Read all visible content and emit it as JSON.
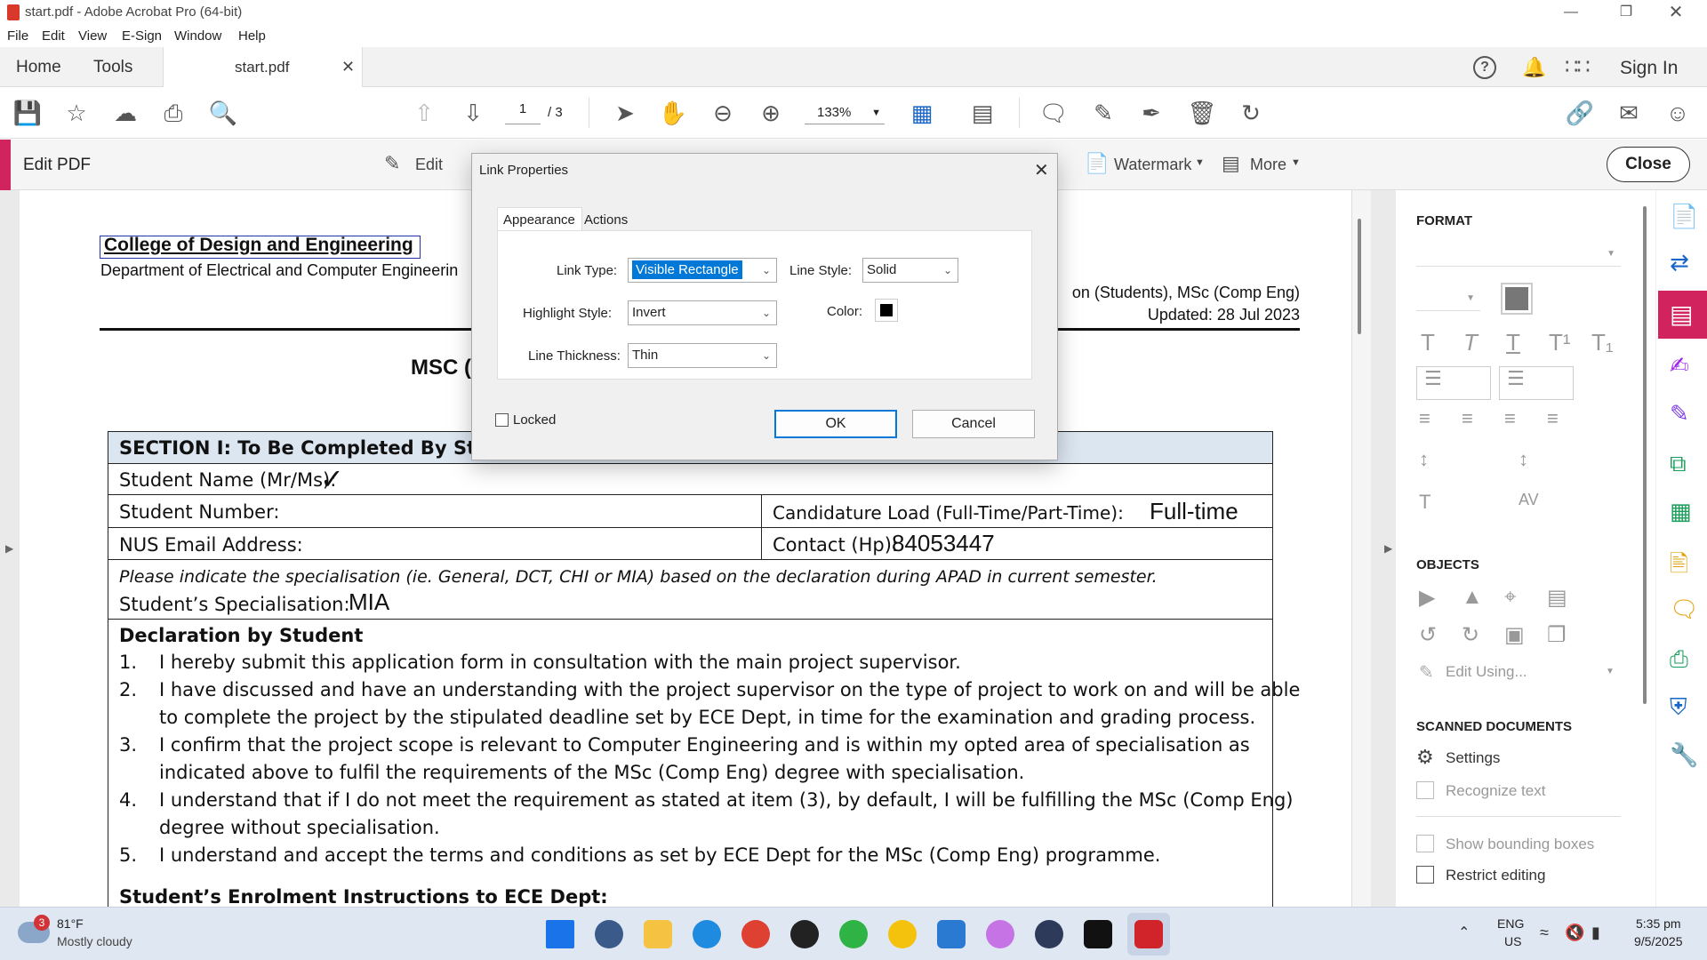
{
  "window": {
    "title": "start.pdf - Adobe Acrobat Pro (64-bit)"
  },
  "menu": [
    "File",
    "Edit",
    "View",
    "E-Sign",
    "Window",
    "Help"
  ],
  "tabs": {
    "home": "Home",
    "tools": "Tools",
    "doc": "start.pdf",
    "sign_in": "Sign In"
  },
  "toolbar": {
    "page_current": "1",
    "page_total": "/ 3",
    "zoom": "133%"
  },
  "editbar": {
    "title": "Edit PDF",
    "edit": "Edit",
    "watermark": "Watermark",
    "more": "More",
    "close": "Close"
  },
  "document": {
    "org": "College of Design and Engineering",
    "dept": "Department of Electrical and Computer Engineerin",
    "header_right_1": "on (Students), MSc (Comp Eng)",
    "header_right_2": "Updated: 28 Jul 2023",
    "heading_fragment": "MSC (",
    "section_header": "SECTION I: To Be Completed By Stude",
    "student_name_label": "Student Name (Mr/Ms):",
    "student_number_label": "Student Number:",
    "load_label": "Candidature Load (Full-Time/Part-Time):",
    "load_value": "Full-time",
    "email_label": "NUS Email Address:",
    "contact_label": "Contact (Hp):",
    "contact_value": "84053447",
    "spec_instruction": "Please indicate the specialisation (ie. General, DCT, CHI or MIA) based on the declaration during APAD in current semester.",
    "spec_label": "Student’s Specialisation:",
    "spec_value": "MIA",
    "declaration_title": "Declaration by Student",
    "declarations": [
      {
        "num": "1.",
        "line1": "I hereby submit this application form in consultation with the main project supervisor.",
        "line2": ""
      },
      {
        "num": "2.",
        "line1": "I have discussed and have an understanding with the project supervisor on the type of project to work on and will be able",
        "line2": "to complete the project by the stipulated deadline set by ECE Dept, in time for the examination and grading process."
      },
      {
        "num": "3.",
        "line1": "I confirm that the project scope is relevant to Computer Engineering and is within my opted area of specialisation as",
        "line2": "indicated above to fulfil the requirements of the MSc (Comp Eng) degree with specialisation."
      },
      {
        "num": "4.",
        "line1": "I understand that if I do not meet the requirement as stated at item (3), by default, I will be fulfilling the MSc (Comp Eng)",
        "line2": "degree without specialisation."
      },
      {
        "num": "5.",
        "line1": "I understand and accept the terms and conditions as set by ECE Dept for the MSc (Comp Eng) programme.",
        "line2": ""
      }
    ],
    "enrolment_title": "Student’s Enrolment Instructions to ECE Dept:"
  },
  "dialog": {
    "title": "Link Properties",
    "tab_appearance": "Appearance",
    "tab_actions": "Actions",
    "link_type_label": "Link Type:",
    "link_type_value": "Visible Rectangle",
    "line_style_label": "Line Style:",
    "line_style_value": "Solid",
    "highlight_label": "Highlight Style:",
    "highlight_value": "Invert",
    "color_label": "Color:",
    "color_value": "#000000",
    "thickness_label": "Line Thickness:",
    "thickness_value": "Thin",
    "locked_label": "Locked",
    "ok": "OK",
    "cancel": "Cancel"
  },
  "right_panel": {
    "format_title": "FORMAT",
    "objects_title": "OBJECTS",
    "edit_using": "Edit Using...",
    "scanned_title": "SCANNED DOCUMENTS",
    "settings": "Settings",
    "recognize_text": "Recognize text",
    "show_bounding": "Show bounding boxes",
    "restrict_editing": "Restrict editing"
  },
  "taskbar": {
    "weather_temp": "81°F",
    "weather_desc": "Mostly cloudy",
    "weather_badge": "3",
    "lang1": "ENG",
    "lang2": "US",
    "time": "5:35 pm",
    "date": "9/5/2025"
  },
  "colors": {
    "accent": "#d1235e",
    "dialog_select": "#0078d7",
    "section_bg": "#dce6f1"
  }
}
